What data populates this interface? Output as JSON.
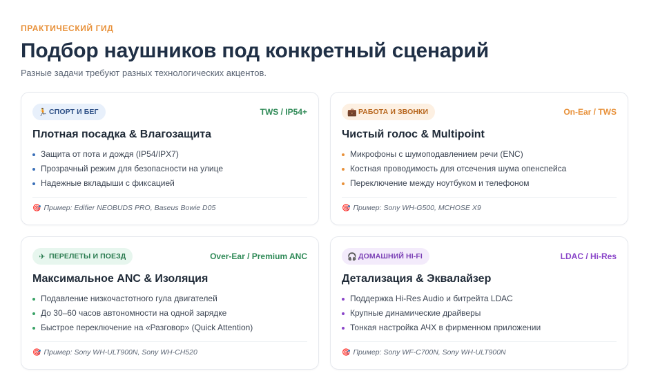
{
  "header": {
    "eyebrow": "ПРАКТИЧЕСКИЙ ГИД",
    "title": "Подбор наушников под конкретный сценарий",
    "subtitle": "Разные задачи требуют разных технологических акцентов."
  },
  "cards": [
    {
      "tag_icon": "runner-icon",
      "tag_glyph": "🏃",
      "tag": "СПОРТ И БЕГ",
      "meta": "TWS / IP54+",
      "title": "Плотная посадка & Влагозащита",
      "features": [
        "Защита от пота и дождя (IP54/IPX7)",
        "Прозрачный режим для безопасности на улице",
        "Надежные вкладыши с фиксацией"
      ],
      "example_icon": "target-icon",
      "example": "Пример: Edifier NEOBUDS PRO, Baseus Bowie D05",
      "accent": "#3a6fb8"
    },
    {
      "tag_icon": "briefcase-icon",
      "tag_glyph": "💼",
      "tag": "РАБОТА И ЗВОНКИ",
      "meta": "On-Ear / TWS",
      "title": "Чистый голос & Multipoint",
      "features": [
        "Микрофоны с шумоподавлением речи (ENC)",
        "Костная проводимость для отсечения шума опенспейса",
        "Переключение между ноутбуком и телефоном"
      ],
      "example_icon": "target-icon",
      "example": "Пример: Sony WH-G500, MCHOSE X9",
      "accent": "#e8913a"
    },
    {
      "tag_icon": "airplane-icon",
      "tag_glyph": "✈",
      "tag": "ПЕРЕЛЕТЫ И ПОЕЗД",
      "meta": "Over-Ear / Premium ANC",
      "title": "Максимальное ANC & Изоляция",
      "features": [
        "Подавление низкочастотного гула двигателей",
        "До 30–60 часов автономности на одной зарядке",
        "Быстрое переключение на «Разговор» (Quick Attention)"
      ],
      "example_icon": "target-icon",
      "example": "Пример: Sony WH-ULT900N, Sony WH-CH520",
      "accent": "#39a266"
    },
    {
      "tag_icon": "headphones-icon",
      "tag_glyph": "🎧",
      "tag": "ДОМАШНИЙ HI-FI",
      "meta": "LDAC / Hi-Res",
      "title": "Детализация & Эквалайзер",
      "features": [
        "Поддержка Hi-Res Audio и битрейта LDAC",
        "Крупные динамические драйверы",
        "Тонкая настройка АЧХ в фирменном приложении"
      ],
      "example_icon": "target-icon",
      "example": "Пример: Sony WF-C700N, Sony WH-ULT900N",
      "accent": "#8a45c9"
    }
  ]
}
